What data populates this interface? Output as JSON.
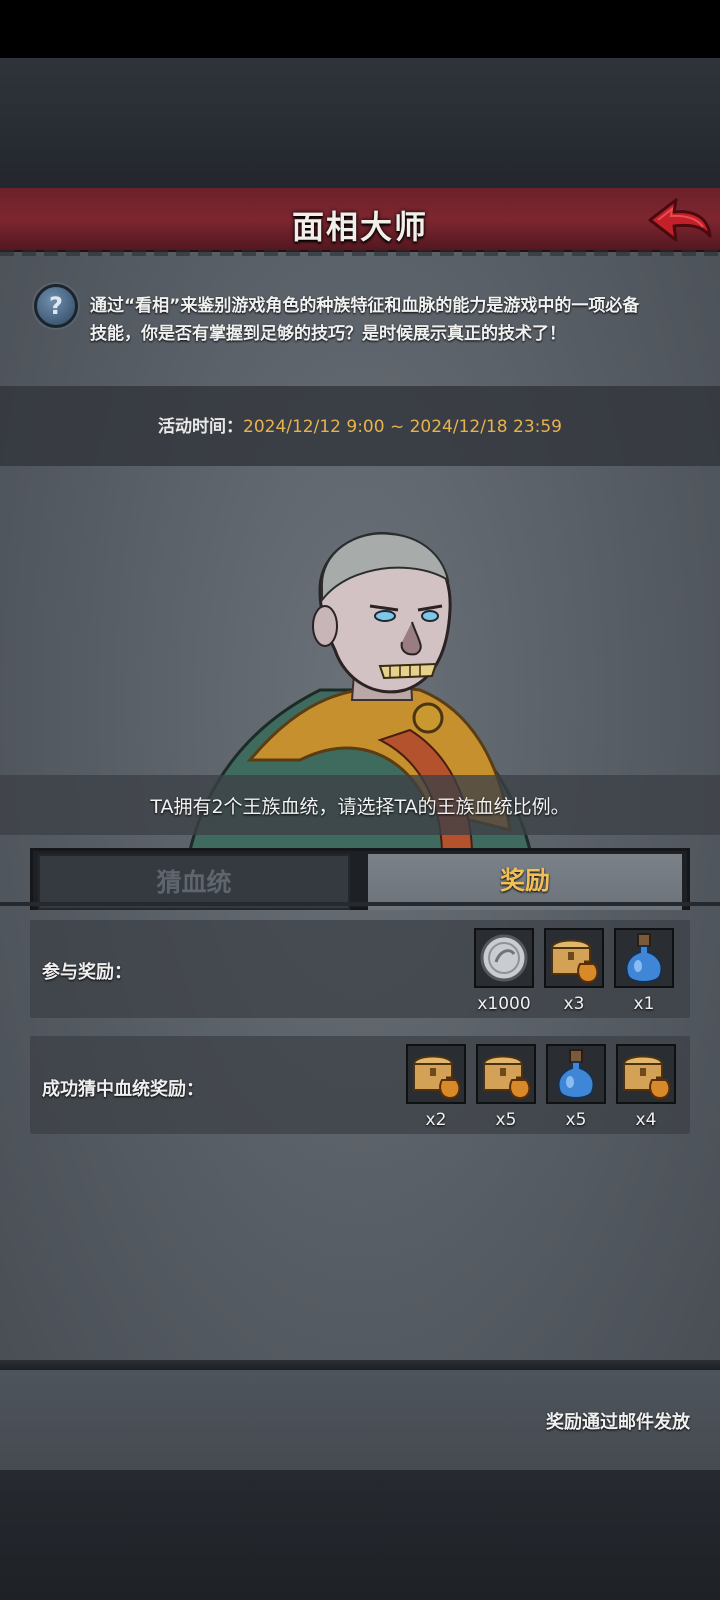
{
  "header": {
    "title": "面相大师"
  },
  "description": "通过“看相”来鉴别游戏角色的种族特征和血脉的能力是游戏中的一项必备技能，你是否有掌握到足够的技巧？是时候展示真正的技术了！",
  "activity": {
    "label": "活动时间：",
    "value": "2024/12/12 9:00 ~ 2024/12/18 23:59"
  },
  "prompt": "TA拥有2个王族血统，请选择TA的王族血统比例。",
  "tabs": [
    {
      "label": "猜血统",
      "active": false
    },
    {
      "label": "奖励",
      "active": true
    }
  ],
  "rewards": {
    "participation": {
      "label": "参与奖励：",
      "items": [
        {
          "icon": "silver-coin-icon",
          "qty": "x1000"
        },
        {
          "icon": "treasure-chest-icon",
          "qty": "x3"
        },
        {
          "icon": "blue-potion-icon",
          "qty": "x1"
        }
      ]
    },
    "success": {
      "label": "成功猜中血统奖励：",
      "items": [
        {
          "icon": "treasure-chest-icon",
          "qty": "x2"
        },
        {
          "icon": "treasure-chest-icon",
          "qty": "x5"
        },
        {
          "icon": "blue-potion-icon",
          "qty": "x5"
        },
        {
          "icon": "treasure-chest-icon",
          "qty": "x4"
        }
      ]
    }
  },
  "footer": {
    "note": "奖励通过邮件发放"
  },
  "colors": {
    "accent": "#f1bf56",
    "title_bar": "#7e2630",
    "date": "#e8b24e"
  }
}
